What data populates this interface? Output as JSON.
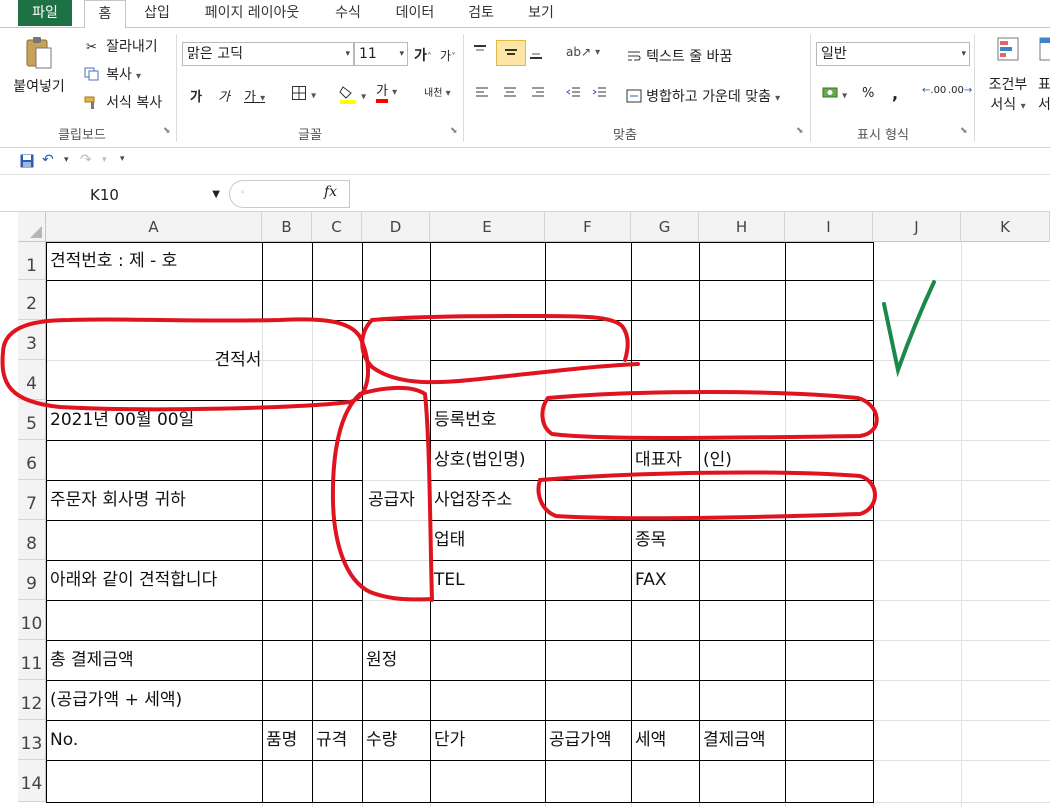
{
  "tabs": {
    "file": "파일",
    "home": "홈",
    "insert": "삽입",
    "page_layout": "페이지 레이아웃",
    "formulas": "수식",
    "data": "데이터",
    "review": "검토",
    "view": "보기"
  },
  "ribbon": {
    "clipboard": {
      "paste": "붙여넣기",
      "cut": "잘라내기",
      "copy": "복사",
      "format_painter": "서식 복사",
      "label": "클립보드"
    },
    "font": {
      "font_name": "맑은 고딕",
      "font_size": "11",
      "grow": "가",
      "shrink": "가",
      "bold": "가",
      "italic": "가",
      "underline": "가",
      "font_color_glyph": "가",
      "phonetic": "내천",
      "label": "글꼴"
    },
    "alignment": {
      "wrap_text": "텍스트 줄 바꿈",
      "merge_center": "병합하고 가운데 맞춤",
      "label": "맞춤"
    },
    "number": {
      "format": "일반",
      "percent": "%",
      "comma": ",",
      "inc_decimal": ".00",
      "dec_decimal": ".00",
      "label": "표시 형식"
    },
    "styles": {
      "conditional_1": "조건부",
      "conditional_2": "서식",
      "table_fmt": "표",
      "table_fmt2": "서"
    }
  },
  "formula_bar": {
    "name_box": "K10",
    "fx": "fx",
    "value": ""
  },
  "columns": [
    "A",
    "B",
    "C",
    "D",
    "E",
    "F",
    "G",
    "H",
    "I",
    "J",
    "K"
  ],
  "rows": [
    "1",
    "2",
    "3",
    "4",
    "5",
    "6",
    "7",
    "8",
    "9",
    "10",
    "11",
    "12",
    "13",
    "14"
  ],
  "cells": {
    "A1": "견적번호 : 제  -  호",
    "A3": "견적서",
    "A5": "2021년    00월    00일",
    "A7": "주문자 회사명     귀하",
    "A9": "아래와 같이 견적합니다",
    "A11": "총 결제금액",
    "A12": "(공급가액 + 세액)",
    "A13": "No.",
    "B13": "품명",
    "C13": "규격",
    "D7": "공급자",
    "D11": "원정",
    "D13": "수량",
    "E5": "등록번호",
    "E6": "상호(법인명)",
    "E7": "사업장주소",
    "E8": "업태",
    "E9": "TEL",
    "E13": "단가",
    "F13": "공급가액",
    "G6": "대표자",
    "H6": "(인)",
    "G8": "종목",
    "G9": "FAX",
    "G13": "세액",
    "H13": "결제금액"
  },
  "colors": {
    "file_tab": "#1e7145",
    "annotation_red": "#e0141e",
    "annotation_green": "#1a8a4a",
    "header_bg": "#f3f3f3"
  }
}
